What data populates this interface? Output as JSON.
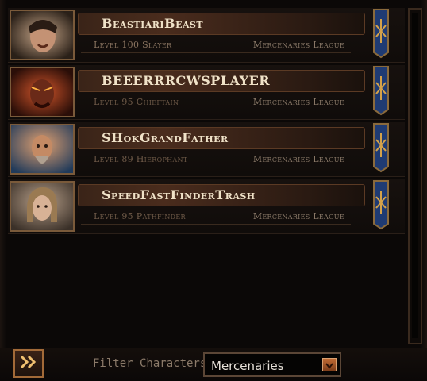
{
  "characters": [
    {
      "name": "BeastiariBeast",
      "level_class": "Level 100 Slayer",
      "league": "Mercenaries League",
      "portrait": "slayer-portrait"
    },
    {
      "name": "BEEERRRCWSPLAYER",
      "level_class": "Level 95 Chieftain",
      "league": "Mercenaries League",
      "portrait": "chieftain-portrait"
    },
    {
      "name": "SHokGrandFather",
      "level_class": "Level 89 Hierophant",
      "league": "Mercenaries League",
      "portrait": "hierophant-portrait"
    },
    {
      "name": "SpeedFastFinderTrash",
      "level_class": "Level 95 Pathfinder",
      "league": "Mercenaries League",
      "portrait": "pathfinder-portrait"
    }
  ],
  "filter": {
    "label": "Filter Characters:",
    "selected": "Mercenaries"
  },
  "colors": {
    "accent": "#a26a38",
    "name_text": "#f0e2c8",
    "banner_blue": "#1f3b73"
  }
}
